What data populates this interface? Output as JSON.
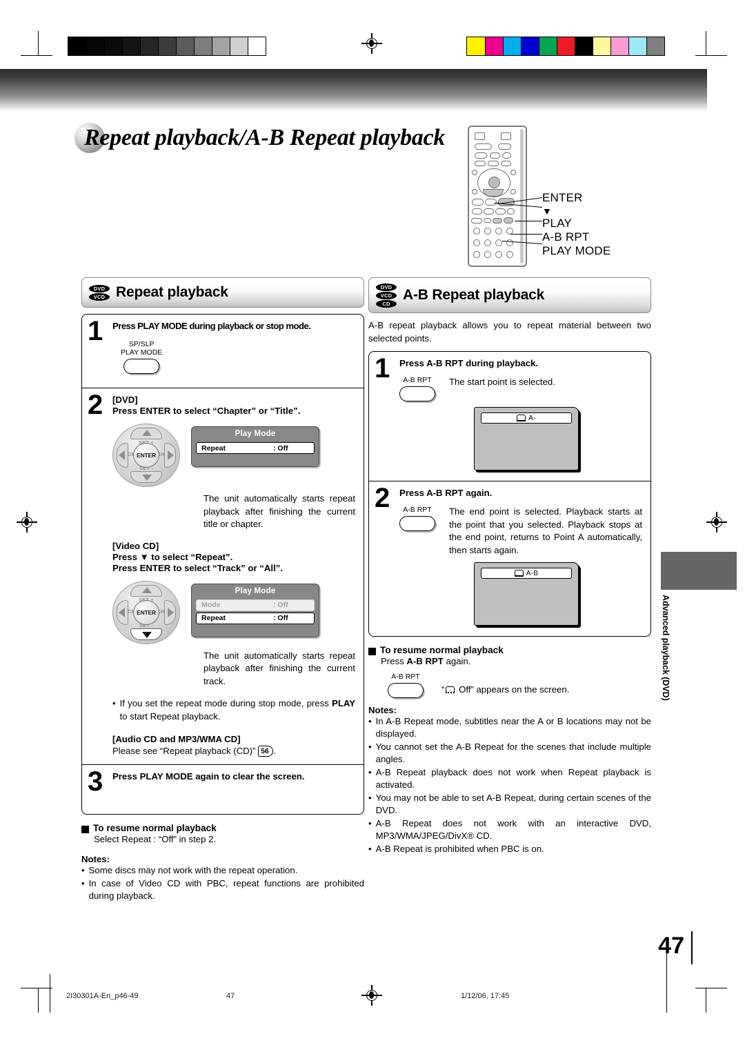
{
  "page": {
    "title": "Repeat playback/A-B Repeat playback",
    "number": "47"
  },
  "side_tab": {
    "label": "Advanced playback (DVD)"
  },
  "remote": {
    "callouts": [
      {
        "label": "ENTER"
      },
      {
        "label": "▼"
      },
      {
        "label": "PLAY"
      },
      {
        "label": "A-B RPT"
      },
      {
        "label": "PLAY MODE"
      }
    ]
  },
  "left_column": {
    "header": {
      "badges": [
        "DVD",
        "VCD"
      ],
      "title": "Repeat playback"
    },
    "step1": {
      "num": "1",
      "title": "Press PLAY MODE during playback or stop mode.",
      "key": {
        "label_line1": "SP/SLP",
        "label_line2": "PLAY MODE"
      }
    },
    "step2": {
      "num": "2",
      "dvd_tag": "[DVD]",
      "dvd_instruction": "Press ENTER to select “Chapter” or “Title”.",
      "dpad": {
        "enter": "ENTER",
        "set_up": "SET +",
        "set_down": "SET -",
        "ch_left": "CH",
        "ch_right": "CH"
      },
      "osd_dvd": {
        "title": "Play Mode",
        "rows": [
          {
            "label": "Repeat",
            "value": ": Off",
            "state": "selected"
          }
        ]
      },
      "dvd_note": "The unit automatically starts repeat playback after finishing the current title or chapter.",
      "vcd_tag": "[Video CD]",
      "vcd_instruction_1": "Press ▼ to select “Repeat”.",
      "vcd_instruction_2": "Press ENTER to select “Track” or “All”.",
      "osd_vcd": {
        "title": "Play Mode",
        "rows": [
          {
            "label": "Mode",
            "value": ": Off",
            "state": "dim"
          },
          {
            "label": "Repeat",
            "value": ": Off",
            "state": "selected"
          }
        ]
      },
      "vcd_note": "The unit automatically starts repeat playback after finishing the current track.",
      "bullet": "If you set the repeat mode during stop mode, press PLAY to start Repeat playback.",
      "bullet_bold": "PLAY",
      "audio_tag": "[Audio CD and MP3/WMA CD]",
      "audio_text_pre": "Please see “Repeat playback (CD)” ",
      "audio_pageref": "56",
      "audio_text_post": "."
    },
    "step3": {
      "num": "3",
      "title": "Press PLAY MODE again to clear the screen."
    },
    "resume": {
      "heading": "To resume normal playback",
      "text": "Select Repeat : “Off” in step 2."
    },
    "notes": {
      "heading": "Notes:",
      "items": [
        "Some discs may not work with the repeat operation.",
        "In case of Video CD with PBC, repeat functions are prohibited during playback."
      ]
    }
  },
  "right_column": {
    "header": {
      "badges": [
        "DVD",
        "VCD",
        "CD"
      ],
      "title": "A-B Repeat playback"
    },
    "intro": "A-B repeat playback allows you to repeat material between two selected points.",
    "step1": {
      "num": "1",
      "title": "Press A-B RPT during playback.",
      "key_label": "A-B RPT",
      "description": "The start point is selected.",
      "screen_text": "A-"
    },
    "step2": {
      "num": "2",
      "title": "Press A-B RPT again.",
      "key_label": "A-B RPT",
      "description": "The end point is selected. Playback starts at the point that you selected. Playback stops at the end point, returns to Point A automatically, then starts again.",
      "screen_text": "A-B"
    },
    "resume": {
      "heading": "To resume normal playback",
      "text_pre": "Press ",
      "text_bold": "A-B RPT",
      "text_post": " again.",
      "key_label": "A-B RPT",
      "screen_note_pre": "“",
      "screen_note_text": " Off” appears on the screen.",
      "screen_note_label": "Off"
    },
    "notes": {
      "heading": "Notes:",
      "items": [
        "In A-B Repeat mode, subtitles near the A or B locations may not be displayed.",
        "You cannot set the A-B Repeat for the scenes that include multiple angles.",
        "A-B Repeat playback does not work when Repeat playback is activated.",
        "You may not be able to set A-B Repeat, during certain scenes of the DVD.",
        "A-B Repeat does not work with an interactive DVD, MP3/WMA/JPEG/DivX® CD.",
        "A-B Repeat is prohibited when PBC is on."
      ]
    }
  },
  "footer": {
    "file": "2I30301A-En_p46-49",
    "page": "47",
    "date": "1/12/06, 17:45"
  },
  "print_marks": {
    "grayscale_steps": [
      "#000000",
      "#050505",
      "#0a0a0a",
      "#141414",
      "#262626",
      "#3d3d3d",
      "#5c5c5c",
      "#7d7d7d",
      "#a3a3a3",
      "#cfcfcf",
      "#ffffff"
    ],
    "color_bars": [
      "#fff200",
      "#ec008c",
      "#00aeef",
      "#0000d4",
      "#00a651",
      "#ed1c24",
      "#000000",
      "#fff79a",
      "#f99dd2",
      "#9ee9f5",
      "#808080"
    ]
  }
}
